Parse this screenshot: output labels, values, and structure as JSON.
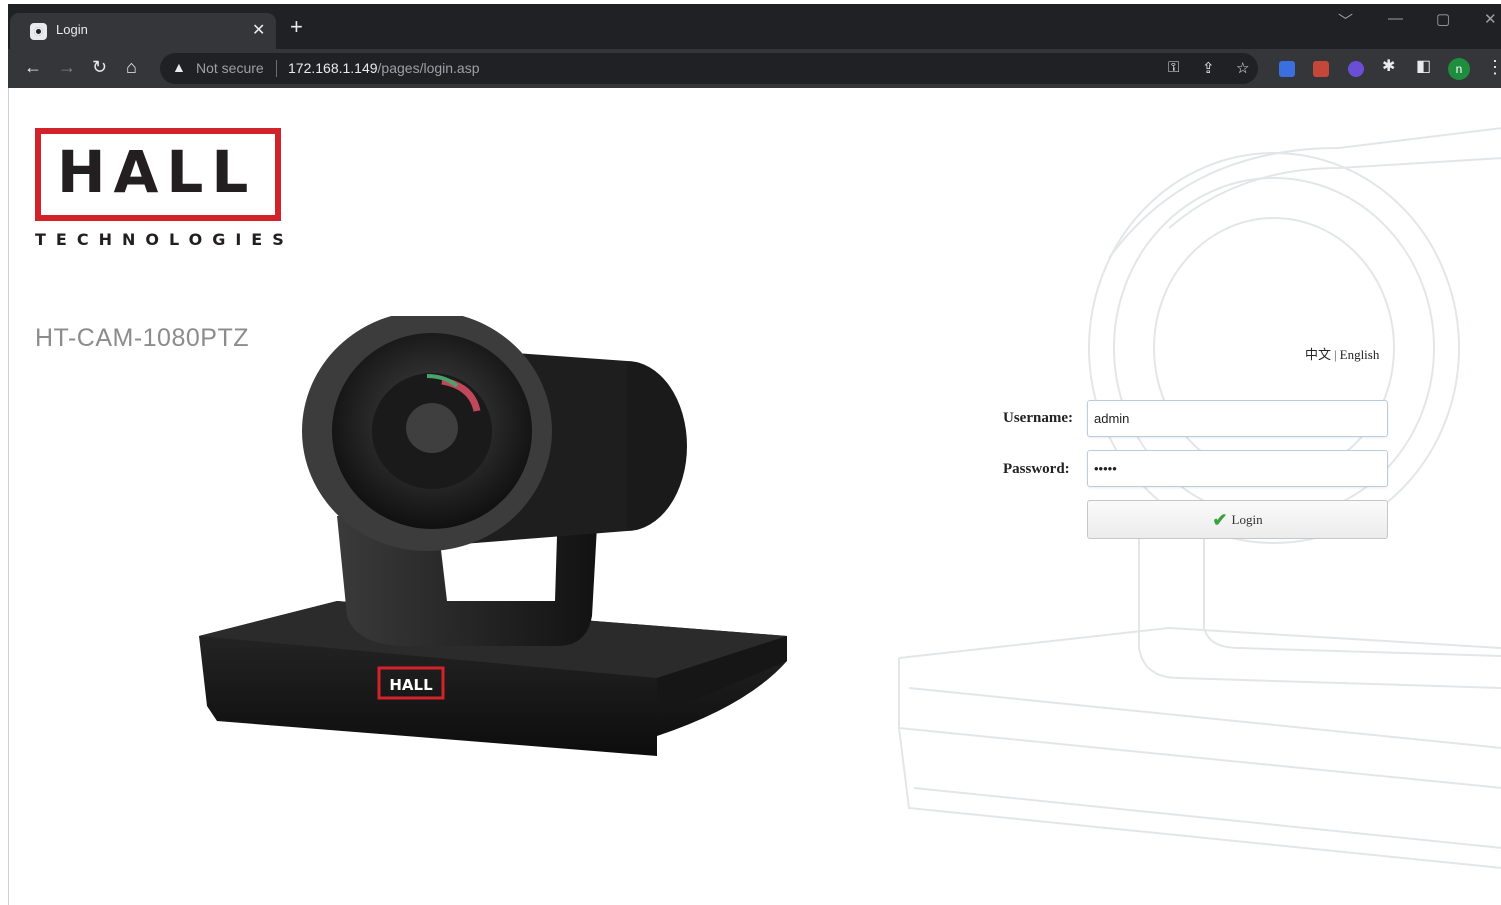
{
  "browser": {
    "tab_title": "Login",
    "tab_close": "✕",
    "new_tab": "+",
    "security_label": "Not secure",
    "url_host": "172.168.1.149",
    "url_path": "/pages/login.asp",
    "profile_initial": "n"
  },
  "page": {
    "logo_word": "HALL",
    "logo_subtitle": "TECHNOLOGIES",
    "model_name": "HT-CAM-1080PTZ",
    "camera_badge": "HALL",
    "lang_chinese": "中文",
    "lang_separator": "|",
    "lang_english": "English"
  },
  "form": {
    "username_label": "Username:",
    "username_value": "admin",
    "password_label": "Password:",
    "password_value": "•••••",
    "login_label": "Login"
  },
  "colors": {
    "brand_red": "#d2232a",
    "chrome_dark": "#202124",
    "field_border": "#b9cde0"
  }
}
